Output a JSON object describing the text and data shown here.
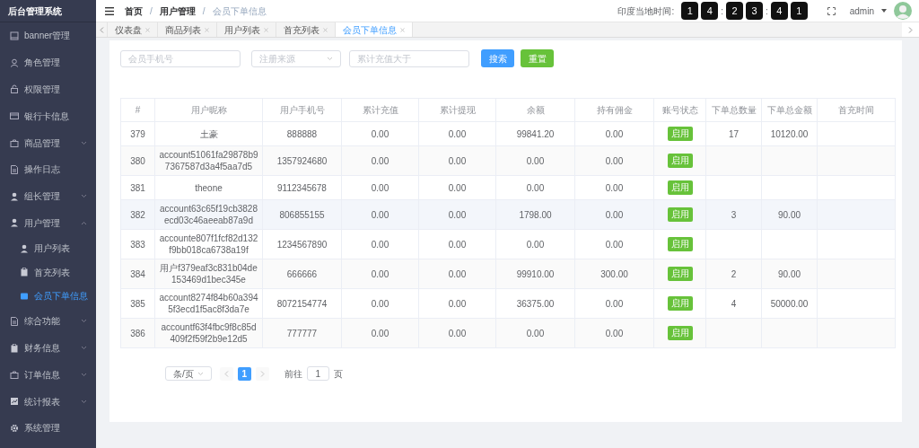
{
  "app_title": "后台管理系统",
  "sidebar": {
    "items": [
      {
        "label": "banner管理",
        "selected": false
      },
      {
        "label": "角色管理",
        "selected": false
      },
      {
        "label": "权限管理",
        "selected": false
      },
      {
        "label": "银行卡信息",
        "selected": false
      },
      {
        "label": "商品管理",
        "expanded": false,
        "selected": false
      },
      {
        "label": "操作日志",
        "selected": false
      },
      {
        "label": "组长管理",
        "expanded": false,
        "selected": false
      },
      {
        "label": "用户管理",
        "expanded": true,
        "selected": false,
        "children": [
          {
            "label": "用户列表",
            "selected": false
          },
          {
            "label": "首充列表",
            "selected": false
          },
          {
            "label": "会员下单信息",
            "selected": true
          }
        ]
      },
      {
        "label": "综合功能",
        "expanded": false,
        "selected": false
      },
      {
        "label": "财务信息",
        "expanded": false,
        "selected": false
      },
      {
        "label": "订单信息",
        "expanded": false,
        "selected": false
      },
      {
        "label": "统计报表",
        "expanded": false,
        "selected": false
      },
      {
        "label": "系统管理",
        "selected": false
      }
    ]
  },
  "breadcrumb": {
    "separator": "/",
    "items": [
      {
        "label": "首页",
        "current": false
      },
      {
        "label": "用户管理",
        "current": false
      },
      {
        "label": "会员下单信息",
        "current": true
      }
    ]
  },
  "clock": {
    "label": "印度当地时间:",
    "separator": ":",
    "groups": [
      [
        "1",
        "4"
      ],
      [
        "2",
        "3"
      ],
      [
        "4",
        "1"
      ]
    ]
  },
  "user": {
    "name": "admin"
  },
  "tabs": [
    {
      "label": "仪表盘",
      "selected": false
    },
    {
      "label": "商品列表",
      "selected": false
    },
    {
      "label": "用户列表",
      "selected": false
    },
    {
      "label": "首充列表",
      "selected": false
    },
    {
      "label": "会员下单信息",
      "selected": true
    }
  ],
  "filters": {
    "fields": [
      {
        "kind": "input",
        "placeholder": "会员手机号"
      },
      {
        "kind": "select",
        "placeholder": "注册来源"
      },
      {
        "kind": "input",
        "placeholder": "累计充值大于"
      }
    ],
    "buttons": [
      {
        "label": "搜索",
        "kind": "primary"
      },
      {
        "label": "重置",
        "kind": "success"
      }
    ]
  },
  "table": {
    "columns": [
      "#",
      "用户昵称",
      "用户手机号",
      "累计充值",
      "累计提现",
      "余额",
      "持有佣金",
      "账号状态",
      "下单总数量",
      "下单总金额",
      "首充时间"
    ],
    "rows": [
      {
        "id": "379",
        "nickname": "土豪",
        "phone": "888888",
        "recharge": "0.00",
        "withdraw": "0.00",
        "balance": "99841.20",
        "commission": "0.00",
        "status": "启用",
        "enabled": true,
        "order_count": "17",
        "order_total": "10120.00",
        "highlighted": false
      },
      {
        "id": "380",
        "nickname": "account51061fa29878b97367587d3a4f5aa7d5",
        "phone": "1357924680",
        "recharge": "0.00",
        "withdraw": "0.00",
        "balance": "0.00",
        "commission": "0.00",
        "status": "启用",
        "enabled": true,
        "highlighted": false
      },
      {
        "id": "381",
        "nickname": "theone",
        "phone": "9112345678",
        "recharge": "0.00",
        "withdraw": "0.00",
        "balance": "0.00",
        "commission": "0.00",
        "status": "启用",
        "enabled": true,
        "highlighted": false
      },
      {
        "id": "382",
        "nickname": "account63c65f19cb3828ecd03c46aeeab87a9d",
        "phone": "806855155",
        "recharge": "0.00",
        "withdraw": "0.00",
        "balance": "1798.00",
        "commission": "0.00",
        "status": "启用",
        "enabled": true,
        "order_count": "3",
        "order_total": "90.00",
        "highlighted": true
      },
      {
        "id": "383",
        "nickname": "accounte807f1fcf82d132f9bb018ca6738a19f",
        "phone": "1234567890",
        "recharge": "0.00",
        "withdraw": "0.00",
        "balance": "0.00",
        "commission": "0.00",
        "status": "启用",
        "enabled": true,
        "highlighted": false
      },
      {
        "id": "384",
        "nickname": "用户f379eaf3c831b04de153469d1bec345e",
        "phone": "666666",
        "recharge": "0.00",
        "withdraw": "0.00",
        "balance": "99910.00",
        "commission": "300.00",
        "status": "启用",
        "enabled": true,
        "order_count": "2",
        "order_total": "90.00",
        "highlighted": false
      },
      {
        "id": "385",
        "nickname": "account8274f84b60a3945f3ecd1f5ac8f3da7e",
        "phone": "8072154774",
        "recharge": "0.00",
        "withdraw": "0.00",
        "balance": "36375.00",
        "commission": "0.00",
        "status": "启用",
        "enabled": true,
        "order_count": "4",
        "order_total": "50000.00",
        "highlighted": false
      },
      {
        "id": "386",
        "nickname": "accountf63f4fbc9f8c85d409f2f59f2b9e12d5",
        "phone": "777777",
        "recharge": "0.00",
        "withdraw": "0.00",
        "balance": "0.00",
        "commission": "0.00",
        "status": "启用",
        "enabled": true,
        "highlighted": false
      }
    ]
  },
  "pagination": {
    "page_size": "条/页",
    "pages": [
      {
        "label": "1",
        "selected": true
      }
    ],
    "prev_disabled": true,
    "next_disabled": true,
    "goto_label": "前往",
    "goto_value": "1",
    "goto_suffix": "页"
  }
}
